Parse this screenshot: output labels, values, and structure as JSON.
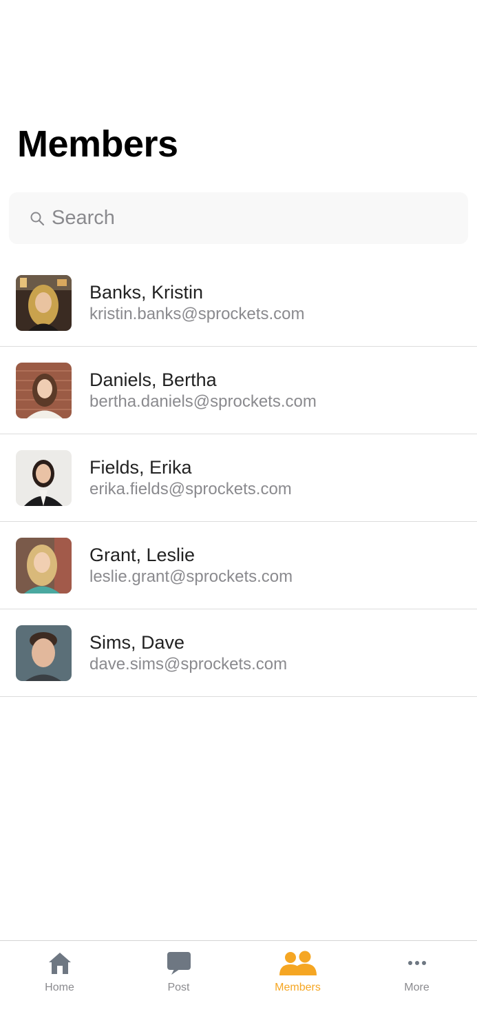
{
  "header": {
    "title": "Members"
  },
  "search": {
    "placeholder": "Search"
  },
  "members": [
    {
      "name": "Banks, Kristin",
      "email": "kristin.banks@sprockets.com"
    },
    {
      "name": "Daniels, Bertha",
      "email": "bertha.daniels@sprockets.com"
    },
    {
      "name": "Fields, Erika",
      "email": "erika.fields@sprockets.com"
    },
    {
      "name": "Grant, Leslie",
      "email": "leslie.grant@sprockets.com"
    },
    {
      "name": "Sims, Dave",
      "email": "dave.sims@sprockets.com"
    }
  ],
  "tabbar": {
    "tabs": [
      {
        "label": "Home",
        "icon": "home-icon",
        "active": false
      },
      {
        "label": "Post",
        "icon": "chat-bubble-icon",
        "active": false
      },
      {
        "label": "Members",
        "icon": "people-icon",
        "active": true
      },
      {
        "label": "More",
        "icon": "more-dots-icon",
        "active": false
      }
    ]
  },
  "colors": {
    "accent": "#f5a623",
    "inactive": "#8a8a8e",
    "icon_gray": "#6e7782"
  }
}
